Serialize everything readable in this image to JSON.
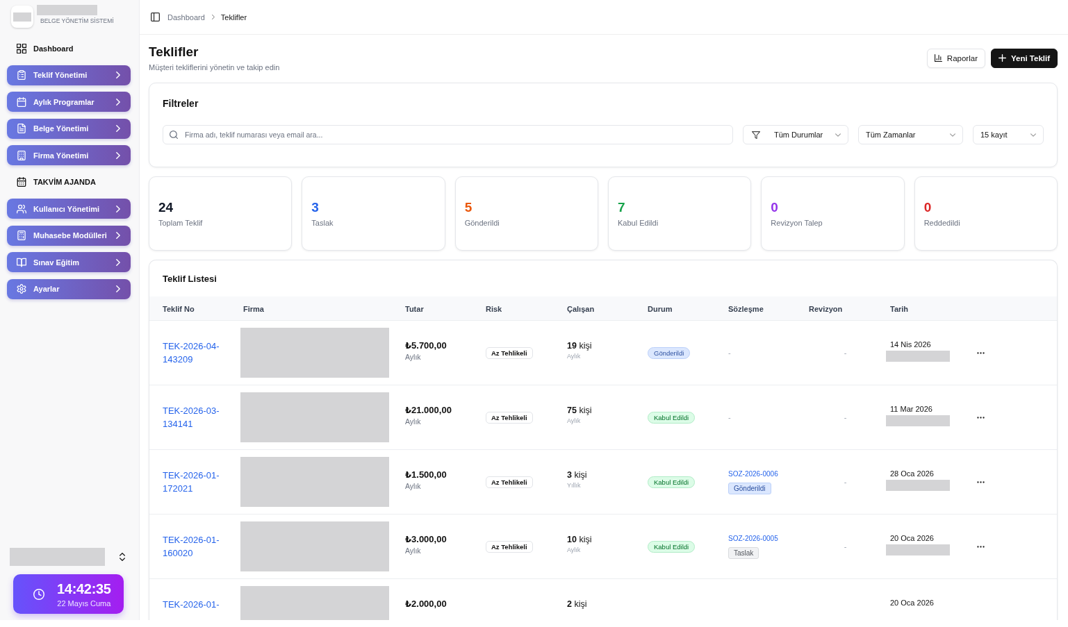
{
  "sidebar": {
    "brand": {
      "logo_redacted": true,
      "name_redacted": true,
      "subtitle": "BELGE YÖNETİM SİSTEMİ"
    },
    "items": [
      {
        "label": "Dashboard",
        "kind": "plain"
      },
      {
        "label": "Teklif Yönetimi",
        "kind": "group",
        "expanded": false
      },
      {
        "label": "Aylık Programlar",
        "kind": "group",
        "expanded": false
      },
      {
        "label": "Belge Yönetimi",
        "kind": "group",
        "expanded": false
      },
      {
        "label": "Firma Yönetimi",
        "kind": "group",
        "expanded": false
      },
      {
        "label": "TAKVİM AJANDA",
        "kind": "plain"
      },
      {
        "label": "Kullanıcı Yönetimi",
        "kind": "group",
        "expanded": false
      },
      {
        "label": "Muhasebe Modülleri",
        "kind": "group",
        "expanded": false
      },
      {
        "label": "Sınav Eğitim",
        "kind": "group",
        "expanded": false
      },
      {
        "label": "Ayarlar",
        "kind": "group",
        "expanded": false
      }
    ],
    "user": {
      "redacted": true
    },
    "clock": {
      "time": "14:42:35",
      "date": "22 Mayıs Cuma"
    }
  },
  "breadcrumb": [
    {
      "label": "Dashboard",
      "selected": false
    },
    {
      "label": "Teklifler",
      "selected": true
    }
  ],
  "page": {
    "title": "Teklifler",
    "subtitle": "Müşteri tekliflerini yönetin ve takip edin",
    "actions": [
      {
        "label": "Raporlar",
        "kind": "outline"
      },
      {
        "label": "Yeni Teklif",
        "kind": "primary"
      }
    ]
  },
  "filters": {
    "title": "Filtreler",
    "search": {
      "placeholder": "Firma adı, teklif numarası veya email ara..."
    },
    "selects": [
      {
        "value": "Tüm Durumlar",
        "kind": "filter"
      },
      {
        "value": "Tüm Zamanlar",
        "kind": "plain"
      },
      {
        "value": "15 kayıt",
        "kind": "plain"
      }
    ]
  },
  "stats": [
    {
      "value": "24",
      "label": "Toplam Teklif",
      "color": "#111827"
    },
    {
      "value": "3",
      "label": "Taslak",
      "color": "#2563eb"
    },
    {
      "value": "5",
      "label": "Gönderildi",
      "color": "#ea580c"
    },
    {
      "value": "7",
      "label": "Kabul Edildi",
      "color": "#16a34a"
    },
    {
      "value": "0",
      "label": "Revizyon Talep",
      "color": "#9333ea"
    },
    {
      "value": "0",
      "label": "Reddedildi",
      "color": "#dc2626"
    }
  ],
  "table": {
    "title": "Teklif Listesi",
    "columns": [
      "Teklif No",
      "Firma",
      "Tutar",
      "Risk",
      "Çalışan",
      "Durum",
      "Sözleşme",
      "Revizyon",
      "Tarih"
    ],
    "rows": [
      {
        "teklif_no": "TEK-2026-04-143209",
        "firma": {
          "redacted": true
        },
        "tutar": {
          "amount": "₺5.700,00",
          "period": "Aylık"
        },
        "risk": "Az Tehlikeli",
        "calisan": {
          "count": "**19** kişi",
          "period": "Aylık"
        },
        "durum": {
          "label": "Gönderildi",
          "color": "#dbe7fe"
        },
        "sozlesme": {
          "kind": "empty",
          "text": "-"
        },
        "revizyon": "-",
        "tarih": {
          "date": "14 Nis 2026",
          "time_redacted": true
        },
        "menu": true
      },
      {
        "teklif_no": "TEK-2026-03-134141",
        "firma": {
          "redacted": true
        },
        "tutar": {
          "amount": "₺21.000,00",
          "period": "Aylık"
        },
        "risk": "Az Tehlikeli",
        "calisan": {
          "count": "**75** kişi",
          "period": "Aylık"
        },
        "durum": {
          "label": "Kabul Edildi",
          "color": "#dcfce7"
        },
        "sozlesme": {
          "kind": "empty",
          "text": "-"
        },
        "revizyon": "-",
        "tarih": {
          "date": "11 Mar 2026",
          "time_redacted": true
        },
        "menu": true
      },
      {
        "teklif_no": "TEK-2026-01-172021",
        "firma": {
          "redacted": true
        },
        "tutar": {
          "amount": "₺1.500,00",
          "period": "Aylık"
        },
        "risk": "Az Tehlikeli",
        "calisan": {
          "count": "**3** kişi",
          "period": "Yıllık"
        },
        "durum": {
          "label": "Kabul Edildi",
          "color": "#dcfce7"
        },
        "sozlesme": {
          "kind": "contract",
          "number": "SOZ-2026-0006",
          "status": "Gönderildi",
          "color": "#dbe7fe"
        },
        "revizyon": "-",
        "tarih": {
          "date": "28 Oca 2026",
          "time_redacted": true
        },
        "menu": true
      },
      {
        "teklif_no": "TEK-2026-01-160020",
        "firma": {
          "redacted": true
        },
        "tutar": {
          "amount": "₺3.000,00",
          "period": "Aylık"
        },
        "risk": "Az Tehlikeli",
        "calisan": {
          "count": "**10** kişi",
          "period": "Aylık"
        },
        "durum": {
          "label": "Kabul Edildi",
          "color": "#dcfce7"
        },
        "sozlesme": {
          "kind": "contract",
          "number": "SOZ-2026-0005",
          "status": "Taslak",
          "color": "#f1f2f4"
        },
        "revizyon": "-",
        "tarih": {
          "date": "20 Oca 2026",
          "time_redacted": true
        },
        "menu": true
      },
      {
        "teklif_no": "TEK-2026-01-",
        "firma": {
          "redacted": true
        },
        "tutar": {
          "amount": "₺2.000,00"
        },
        "calisan": {
          "count": "**2** kişi"
        },
        "tarih": {
          "date": "20 Oca 2026"
        }
      }
    ]
  }
}
